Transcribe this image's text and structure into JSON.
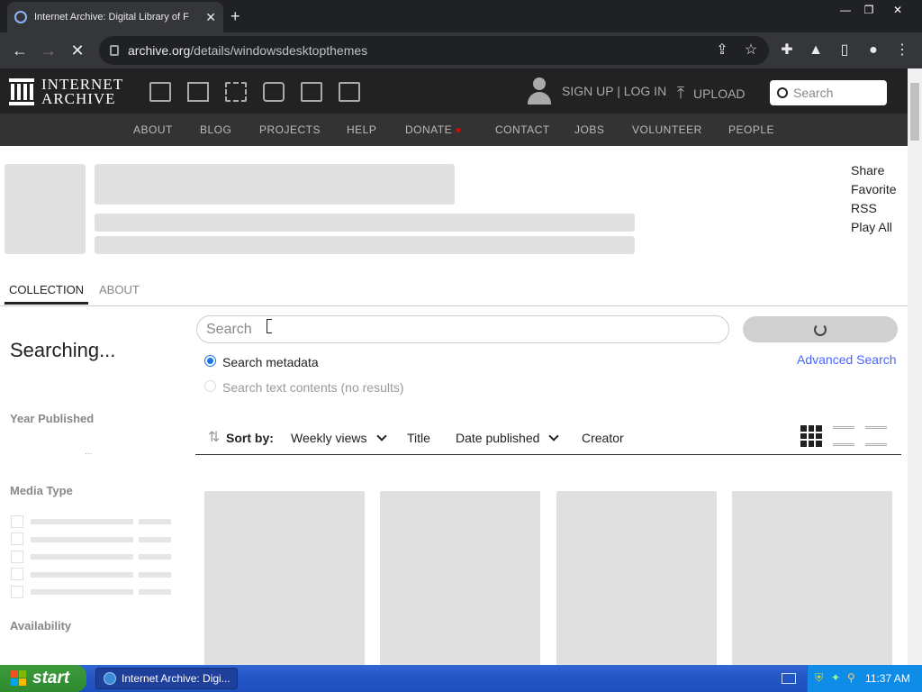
{
  "browser": {
    "tab_title": "Internet Archive: Digital Library of F",
    "url_host": "archive.org",
    "url_path": "/details/windowsdesktopthemes"
  },
  "ia_header": {
    "logo_line1": "INTERNET",
    "logo_line2": "ARCHIVE",
    "signup": "SIGN UP | LOG IN",
    "upload": "UPLOAD",
    "search_placeholder": "Search"
  },
  "ia_nav": {
    "items": [
      "ABOUT",
      "BLOG",
      "PROJECTS",
      "HELP",
      "DONATE",
      "CONTACT",
      "JOBS",
      "VOLUNTEER",
      "PEOPLE"
    ]
  },
  "side_links": [
    "Share",
    "Favorite",
    "RSS",
    "Play All"
  ],
  "content_tabs": [
    "COLLECTION",
    "ABOUT"
  ],
  "collection": {
    "status": "Searching...",
    "search_placeholder": "Search",
    "radio_metadata": "Search metadata",
    "radio_text": "Search text contents (no results)",
    "advanced_search": "Advanced Search",
    "facets": [
      "Year Published",
      "Media Type",
      "Availability"
    ],
    "year_placeholder": "..."
  },
  "sort": {
    "label": "Sort by:",
    "weekly": "Weekly views",
    "title": "Title",
    "date": "Date published",
    "creator": "Creator"
  },
  "taskbar": {
    "start": "start",
    "task": "Internet Archive: Digi...",
    "clock": "11:37 AM"
  },
  "colors": {
    "header_bg": "#222222",
    "nav_bg": "#333333",
    "link_blue": "#4b64ff",
    "xp_blue": "#2456c4",
    "xp_green": "#3c9a3c"
  }
}
